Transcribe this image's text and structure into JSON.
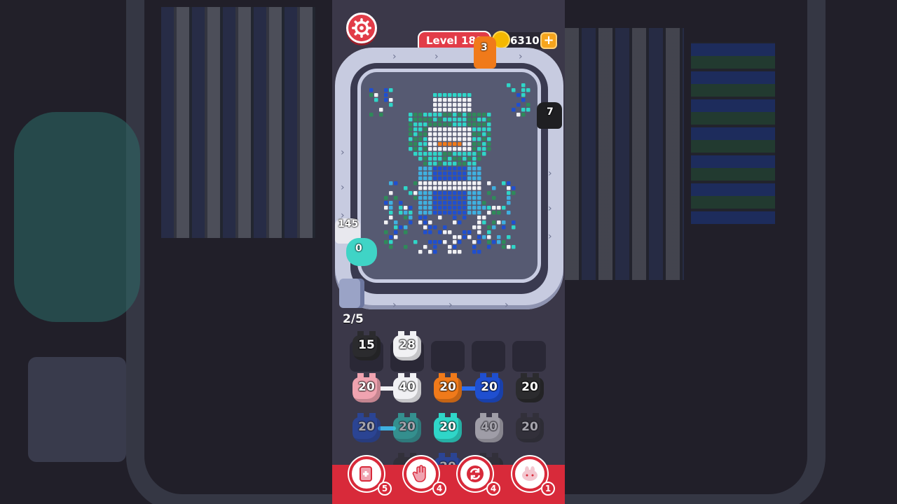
{
  "hud": {
    "level_label": "Level 189",
    "coins": "6310",
    "add_coins_label": "+"
  },
  "board": {
    "top_car_count": "3",
    "right_car_count": "7",
    "counter_top": "145",
    "counter_bottom": "0",
    "slots_used": "2/5"
  },
  "queue": [
    {
      "value": "15",
      "color": "#2b2b2e"
    },
    {
      "value": "28",
      "color": "#f1f1f4"
    }
  ],
  "grid_rows": [
    [
      {
        "value": "20",
        "color": "#f0a3b0"
      },
      {
        "value": "40",
        "color": "#f1f1f4"
      },
      {
        "value": "20",
        "color": "#f07a1a"
      },
      {
        "value": "20",
        "color": "#1f4fd0"
      },
      {
        "value": "20",
        "color": "#2b2b2e"
      }
    ],
    [
      {
        "value": "20",
        "color": "#1f4fd0"
      },
      {
        "value": "20",
        "color": "#2fd6c8"
      },
      {
        "value": "20",
        "color": "#2fd6c8"
      },
      {
        "value": "40",
        "color": "#f1f1f4"
      },
      {
        "value": "20",
        "color": "#2b2b2e"
      }
    ]
  ],
  "partial_row": [
    {
      "value": "",
      "color": "#2b2b2e"
    },
    {
      "value": "20",
      "color": "#1f4fd0"
    },
    {
      "value": "",
      "color": "#2b2b2e"
    }
  ],
  "powerups": [
    {
      "icon": "add-slot-icon",
      "count": "5"
    },
    {
      "icon": "hand-icon",
      "count": "4"
    },
    {
      "icon": "shuffle-icon",
      "count": "4"
    },
    {
      "icon": "magnet-icon",
      "count": "1"
    }
  ],
  "colors": {
    "accent_red": "#e23c48",
    "coin_gold": "#f5b800",
    "track": "#c7cbe0",
    "panel_bg": "#3b3849"
  }
}
